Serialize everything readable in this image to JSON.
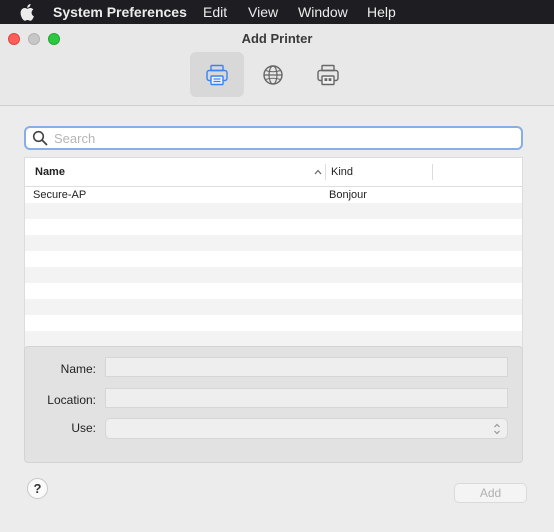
{
  "menubar": {
    "app_name": "System Preferences",
    "items": [
      "Edit",
      "View",
      "Window",
      "Help"
    ]
  },
  "window": {
    "title": "Add Printer",
    "toolbar": [
      {
        "icon": "printer-icon",
        "active": true
      },
      {
        "icon": "globe-icon",
        "active": false
      },
      {
        "icon": "fax-printer-icon",
        "active": false
      }
    ]
  },
  "search": {
    "placeholder": "Search",
    "value": ""
  },
  "table": {
    "columns": [
      "Name",
      "Kind"
    ],
    "sort_column": "Name",
    "sort_direction": "ascending",
    "rows": [
      {
        "name": "Secure-AP",
        "kind": "Bonjour"
      }
    ]
  },
  "details": {
    "name_label": "Name:",
    "location_label": "Location:",
    "use_label": "Use:",
    "name_value": "",
    "location_value": "",
    "use_value": ""
  },
  "buttons": {
    "help_label": "?",
    "add_label": "Add"
  },
  "colors": {
    "close": "#fe5f57",
    "minimize": "#c7c7c7",
    "zoom": "#2bc840",
    "accent": "#3b82f6",
    "focus_ring": "#86aee9"
  }
}
